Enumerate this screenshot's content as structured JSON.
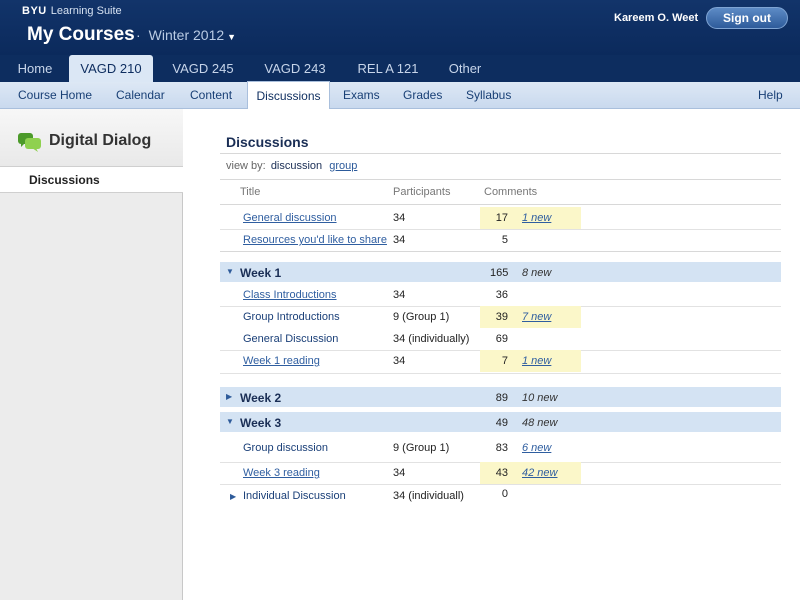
{
  "header": {
    "brand_mark": "BYU",
    "brand_text": "Learning Suite",
    "title": "My Courses",
    "semester": "Winter 2012",
    "user_name": "Kareem O. Weet",
    "sign_out_label": "Sign out"
  },
  "course_tabs": [
    "Home",
    "VAGD 210",
    "VAGD 245",
    "VAGD 243",
    "REL A 121",
    "Other"
  ],
  "section_tabs": [
    "Course Home",
    "Calendar",
    "Content",
    "Discussions",
    "Exams",
    "Grades",
    "Syllabus"
  ],
  "help_label": "Help",
  "sidebar": {
    "name": "Digital Dialog",
    "item": "Discussions",
    "icon": "chat-bubbles-icon"
  },
  "main": {
    "heading": "Discussions",
    "view_by_label": "view by:",
    "view_current": "discussion",
    "view_alt": "group",
    "columns": {
      "title": "Title",
      "participants": "Participants",
      "comments": "Comments"
    }
  },
  "rows": {
    "general": {
      "title": "General discussion",
      "participants": "34",
      "comments": "17",
      "new": "1 new"
    },
    "resources": {
      "title": "Resources you'd like to share",
      "participants": "34",
      "comments": "5"
    },
    "class_intro": {
      "title": "Class Introductions",
      "participants": "34",
      "comments": "36"
    },
    "group_intro": {
      "title": "Group Introductions",
      "participants": "9 (Group 1)",
      "comments": "39",
      "new": "7 new"
    },
    "general_disc": {
      "title": "General Discussion",
      "participants": "34 (individually)",
      "comments": "69"
    },
    "week1_reading": {
      "title": "Week 1 reading",
      "participants": "34",
      "comments": "7",
      "new": "1 new"
    },
    "group_disc": {
      "title": "Group discussion",
      "participants": "9 (Group 1)",
      "comments": "83",
      "new": "6 new"
    },
    "week3_reading": {
      "title": "Week 3 reading",
      "participants": "34",
      "comments": "43",
      "new": "42 new"
    },
    "individual": {
      "title": "Individual Discussion",
      "participants": "34 (individuall)",
      "comments": "0"
    }
  },
  "weeks": {
    "week1": {
      "title": "Week 1",
      "comments": "165",
      "new": "8 new",
      "expanded": true
    },
    "week2": {
      "title": "Week 2",
      "comments": "89",
      "new": "10 new",
      "expanded": false
    },
    "week3": {
      "title": "Week 3",
      "comments": "49",
      "new": "48 new",
      "expanded": true
    }
  },
  "colors": {
    "header_bg": "#0b2a5c",
    "tab_bar_bg": "#0d2d5f",
    "section_bar_bg": "#d2e1f2",
    "week_row_bg": "#d4e3f3",
    "highlight_bg": "#fbf7c9",
    "link": "#2f5ea0"
  }
}
